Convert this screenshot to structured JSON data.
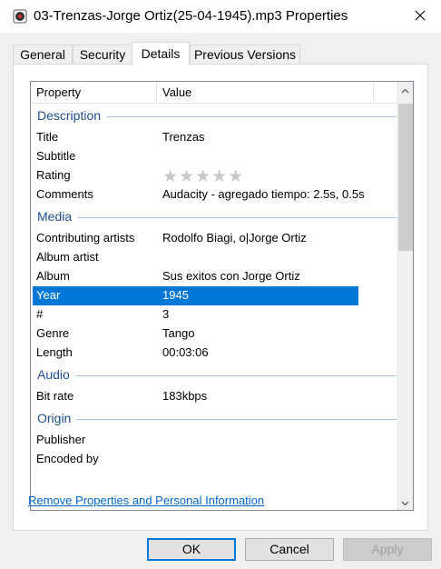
{
  "window": {
    "title": "03-Trenzas-Jorge Ortiz(25-04-1945).mp3 Properties",
    "icon": "audio-file-icon",
    "close_icon": "close-icon"
  },
  "tabs": [
    {
      "label": "General"
    },
    {
      "label": "Security"
    },
    {
      "label": "Details"
    },
    {
      "label": "Previous Versions"
    }
  ],
  "active_tab": "Details",
  "details": {
    "col_property": "Property",
    "col_value": "Value",
    "groups": {
      "description": "Description",
      "media": "Media",
      "audio": "Audio",
      "origin": "Origin"
    },
    "rows": {
      "title": {
        "property": "Title",
        "value": "Trenzas"
      },
      "subtitle": {
        "property": "Subtitle",
        "value": ""
      },
      "rating": {
        "property": "Rating",
        "stars": "★★★★★",
        "rating_value": 0,
        "rating_max": 5
      },
      "comments": {
        "property": "Comments",
        "value": "Audacity - agregado tiempo: 2.5s, 0.5s"
      },
      "contributing_artists": {
        "property": "Contributing artists",
        "value": "Rodolfo Biagi, o|Jorge Ortiz"
      },
      "album_artist": {
        "property": "Album artist",
        "value": ""
      },
      "album": {
        "property": "Album",
        "value": "Sus exitos con Jorge Ortiz"
      },
      "year": {
        "property": "Year",
        "value": "1945"
      },
      "track": {
        "property": "#",
        "value": "3"
      },
      "genre": {
        "property": "Genre",
        "value": "Tango"
      },
      "length": {
        "property": "Length",
        "value": "00:03:06"
      },
      "bit_rate": {
        "property": "Bit rate",
        "value": "183kbps"
      },
      "publisher": {
        "property": "Publisher",
        "value": ""
      },
      "encoded_by": {
        "property": "Encoded by",
        "value": ""
      }
    },
    "selected_row": "Year"
  },
  "remove_link": "Remove Properties and Personal Information",
  "buttons": {
    "ok": "OK",
    "cancel": "Cancel",
    "apply": "Apply"
  },
  "colors": {
    "selection": "#0078d7",
    "group_text": "#1e4e8c",
    "link": "#0066cc"
  }
}
